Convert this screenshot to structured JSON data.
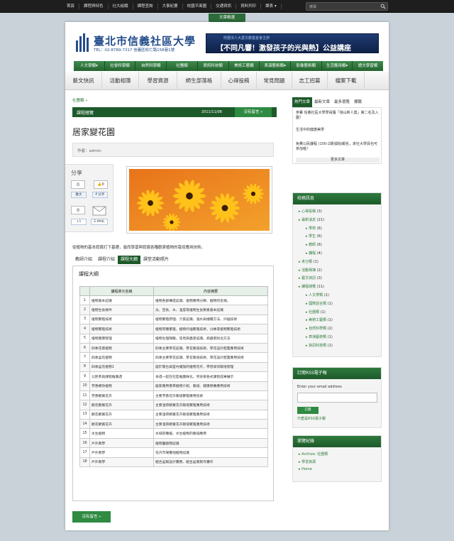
{
  "topnav": [
    "首頁",
    "課程與特色",
    "社大組織",
    "課程查詢",
    "大事紀要",
    "校園平面圖",
    "交通資訊",
    "資料列印",
    "課表"
  ],
  "topnav_caret": "▾",
  "search": {
    "placeholder": "搜尋"
  },
  "top_tab": "文章精選",
  "logo": {
    "title": "臺北市信義社區大學",
    "sub": "TEL：02-8789-7317 信義區松仁路158巷1號"
  },
  "banner": {
    "small": "財團法人大愛文教基金會主辦",
    "main": "【不同凡響！激發孩子的光與熱】公益講座"
  },
  "mainnav": [
    "人文學類▾",
    "社會科學類",
    "自然科學類",
    "社團類",
    "資訊科技類",
    "美術工藝類",
    "表演藝術類▾",
    "影像藝術類",
    "生活應用類▾",
    "語文學習類"
  ],
  "subnav": [
    "藝文快訊",
    "活動相簿",
    "學習資源",
    "師生部落格",
    "心得投稿",
    "常見問題",
    "志工招募",
    "檔案下載"
  ],
  "breadcrumb": "社團類 »",
  "headbar": {
    "label": "課程總覽",
    "date": "2011/11/08",
    "more": "沒有留言 »"
  },
  "post_title": "居家變花園",
  "author": "作者：admin",
  "share": {
    "heading": "分享",
    "c1": "0",
    "like": "讚",
    "c2": "0",
    "push": "推文",
    "shared": "分享",
    "c3": "0",
    "google": "+1",
    "mail": "E-MAIL",
    "c4": "0"
  },
  "intro": "從植物的基本認識打下基礎，進而學習與認識各種觀賞植物的栽培應用技術。",
  "ctabs": [
    "教師介紹",
    "課程介紹",
    "課程大綱",
    "課堂活動照片"
  ],
  "outline": {
    "heading": "課程大綱",
    "headers": [
      "",
      "課程單元名稱",
      "內容摘要"
    ],
    "rows": [
      [
        "1",
        "植物基本認識",
        "植物各部構造認識、植物應用分類、植物的名稱。"
      ],
      [
        "2",
        "植物生長條件",
        "光、空氣、水、溫度等植物生長要素基本認識"
      ],
      [
        "3",
        "植物繁殖技術",
        "植物繁殖原理、介質認識、澆水與播種方法、扦插技術"
      ],
      [
        "4",
        "植物繁殖技術",
        "植物育種繁殖、植物扦插繁殖技術、分株等植物繁殖技術"
      ],
      [
        "5",
        "植物健康管理",
        "植物生理障礙、常見病蟲害認識、病蟲害防治方法"
      ],
      [
        "6",
        "四季花壇植物",
        "四季主要草花認識、草花栽培技術、草花設計配置應用技術"
      ],
      [
        "7",
        "四季盆花植物",
        "四季主要草花認識、草花栽培技術、草花設計配置應用技術"
      ],
      [
        "8",
        "四季盆花植物1",
        "居於陽台與室內擺放的植物花卉，學習如何栽培管理"
      ],
      [
        "9",
        "公民參與課程推廣週",
        "本週一起在社區推廣綠化，另安排各式課程成果展示"
      ],
      [
        "10",
        "芳香療效植物",
        "居家應用香草植物介紹、栽培、健康保養應用技術"
      ],
      [
        "11",
        "芳香觀賞花卉",
        "主要芳香花卉栽培繁殖應用技術"
      ],
      [
        "12",
        "觀花觀賞花卉",
        "主要溫帶觀賞花卉栽培繁殖應用技術"
      ],
      [
        "13",
        "觀花觀賞花卉",
        "主要溫帶觀賞花卉栽培繁殖應用技術"
      ],
      [
        "14",
        "觀花觀賞花卉",
        "主要溫帶觀賞花卉栽培繁殖應用技術"
      ],
      [
        "15",
        "水生植物",
        "水域的種植、水生植物的栽培應用"
      ],
      [
        "16",
        "戶外教學",
        "植物園植物認識"
      ],
      [
        "17",
        "戶外教學",
        "花卉市場實地植物認識"
      ],
      [
        "18",
        "戶外教學",
        "組合盆栽設計實務、組合盆栽製作實作"
      ]
    ]
  },
  "more_button": "沒有留言 »",
  "sidebar": {
    "tabs": [
      "熱門文章",
      "最新文章",
      "最多瀏覽",
      "標籤"
    ],
    "posts": [
      "參賽 信義社區大學學員獲「嶺山新人獎」第二名及入圍！",
      "生活中的健康美學",
      "免費公民課程 (100-2期)開始報名，來社大學員也可參加喔！"
    ],
    "posts_more": "更多文章",
    "cat_title": "校務訊息",
    "cats": [
      {
        "name": "心得投稿",
        "n": "(3)",
        "indent": 0
      },
      {
        "name": "最新消息",
        "n": "(21)",
        "indent": 0
      },
      {
        "name": "學校",
        "n": "(6)",
        "indent": 1
      },
      {
        "name": "學生",
        "n": "(6)",
        "indent": 1
      },
      {
        "name": "教師",
        "n": "(6)",
        "indent": 1
      },
      {
        "name": "課程",
        "n": "(4)",
        "indent": 1
      },
      {
        "name": "未分類",
        "n": "(1)",
        "indent": 0
      },
      {
        "name": "活動相簿",
        "n": "(2)",
        "indent": 0
      },
      {
        "name": "藝文快訊",
        "n": "(3)",
        "indent": 0
      },
      {
        "name": "課程總覽",
        "n": "(11)",
        "indent": 0
      },
      {
        "name": "人文學類",
        "n": "(1)",
        "indent": 1
      },
      {
        "name": "國際語言類",
        "n": "(1)",
        "indent": 1
      },
      {
        "name": "社團類",
        "n": "(1)",
        "indent": 1
      },
      {
        "name": "美術工藝類",
        "n": "(1)",
        "indent": 1
      },
      {
        "name": "自然科學類",
        "n": "(2)",
        "indent": 1
      },
      {
        "name": "表演藝術類",
        "n": "(1)",
        "indent": 1
      },
      {
        "name": "資訊科技類",
        "n": "(1)",
        "indent": 1
      }
    ],
    "rss_title": "訂閱RSS電子報",
    "rss_label": "Enter your email address",
    "rss_button": "訂閱",
    "rss_link": "什麼是RSS電子報",
    "browse_title": "瀏覽紀錄",
    "browse": [
      "Archive: 社團類",
      "學習資源",
      "Home"
    ]
  }
}
